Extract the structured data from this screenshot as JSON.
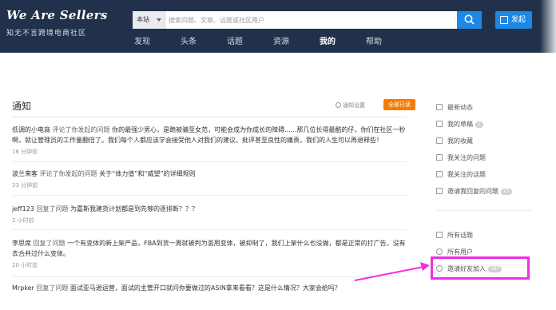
{
  "header": {
    "logo_title": "We Are Sellers",
    "logo_subtitle": "知无不言跨境电商社区",
    "search_scope": "本站",
    "search_placeholder": "搜索问题、文章、话题或社区用户",
    "publish_label": "发起"
  },
  "nav": [
    {
      "label": "发现",
      "active": false
    },
    {
      "label": "头条",
      "active": false
    },
    {
      "label": "话题",
      "active": false
    },
    {
      "label": "资源",
      "active": false
    },
    {
      "label": "我的",
      "active": true
    },
    {
      "label": "帮助",
      "active": false
    }
  ],
  "page": {
    "title": "通知",
    "settings_label": "通知设置",
    "mark_read_label": "全部已读"
  },
  "notifications": [
    {
      "user": "低调的小电商",
      "action": "评论了你发起的问题",
      "topic": "你的最强少男心，是跪被骗至女范，可能会成为你成长的障碍......那几位长得最酷的仔，你们在社区一秒啊，就让管理员的工作量翻倍了。我们每个人都应该学会接受他人对我们的建议、批评甚至良性的痛责，我们的人生可以再退释些！",
      "time": "16 分钟前"
    },
    {
      "user": "波兰来客",
      "action": "评论了你发起的问题",
      "topic": "关于“体力值”和“威望”的详细规则",
      "time": "33 分钟前"
    },
    {
      "user": "jeff123",
      "action": "回复了问题",
      "topic": "为嘉斯我建货计划都是到先够的逐排断？？？",
      "time": "2 小时前"
    },
    {
      "user": "李思席",
      "action": "回复了问题",
      "topic": "一个有变体的新上架产品，FBA到货一周就被判为滥用变体，被抑制了，我们上架什么也没做，都是正常的打广告，没有去合并过什么变体。",
      "time": "20 小时前"
    },
    {
      "user": "Mrpker",
      "action": "回复了问题",
      "topic": "面试亚马逊运营，面试的主管开口就问你要做过的ASIN拿来看看？这是什么情况？大家会给吗？",
      "time": ""
    }
  ],
  "sidebar": {
    "items": [
      {
        "label": "最新动态",
        "icon": "home-icon",
        "badge": ""
      },
      {
        "label": "我的草稿",
        "icon": "draft-icon",
        "badge": "1"
      },
      {
        "label": "我的收藏",
        "icon": "star-icon",
        "badge": ""
      },
      {
        "label": "我关注的问题",
        "icon": "check-list-icon",
        "badge": ""
      },
      {
        "label": "我关注的话题",
        "icon": "tag-icon",
        "badge": ""
      },
      {
        "label": "邀请我回复的问题",
        "icon": "invite-reply-icon",
        "badge": "25"
      },
      {
        "label": "所有话题",
        "icon": "topics-icon",
        "badge": ""
      },
      {
        "label": "所有用户",
        "icon": "users-icon",
        "badge": ""
      },
      {
        "label": "邀请好友加入",
        "icon": "invite-friend-icon",
        "badge": "187"
      }
    ]
  },
  "colors": {
    "header_bg": "#22314b",
    "accent": "#1e88e5",
    "mark_read": "#f57c00",
    "highlight": "#ee2ee8"
  }
}
